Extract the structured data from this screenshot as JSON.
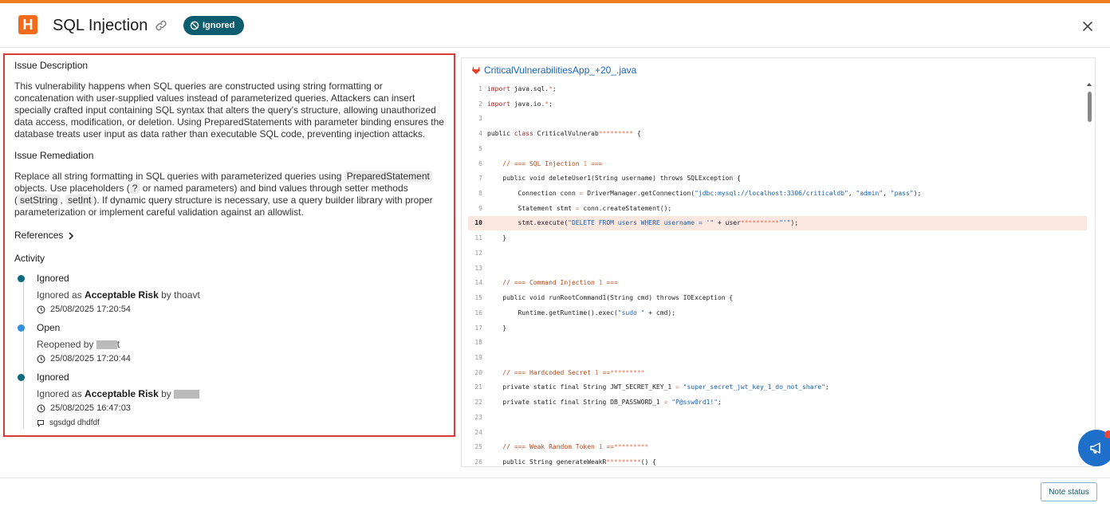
{
  "header": {
    "logo_letter": "H",
    "title": "SQL Injection",
    "status_badge": "Ignored",
    "icons": [
      "link-icon",
      "ban-icon",
      "close-icon"
    ]
  },
  "issue": {
    "description_title": "Issue Description",
    "description": "This vulnerability happens when SQL queries are constructed using string formatting or concatenation with user-supplied values instead of parameterized queries. Attackers can insert specially crafted input containing SQL syntax that alters the query's structure, allowing unauthorized data access, modification, or deletion. Using PreparedStatements with parameter binding ensures the database treats user input as data rather than executable SQL code, preventing injection attacks.",
    "remediation_title": "Issue Remediation",
    "remediation": {
      "t1": "Replace all string formatting in SQL queries with parameterized queries using ",
      "c1": "PreparedStatement",
      "t2": " objects. Use placeholders (",
      "c2": "?",
      "t3": " or named parameters) and bind values through setter methods (",
      "c3": "setString",
      "t4": ", ",
      "c4": "setInt",
      "t5": "). If dynamic query structure is necessary, use a query builder library with proper parameterization or implement careful validation against an allowlist."
    },
    "references_label": "References",
    "activity_title": "Activity"
  },
  "activity": [
    {
      "status": "Ignored",
      "pre": "Ignored as ",
      "bold": "Acceptable Risk",
      "post": " by thoavt",
      "time": "25/08/2025 17:20:54",
      "dot": "#0b6b7d"
    },
    {
      "status": "Open",
      "pre": "Reopened by ",
      "bold": "",
      "post": "t",
      "time": "25/08/2025 17:20:44",
      "dot": "#2f8fe0"
    },
    {
      "status": "Ignored",
      "pre": "Ignored as ",
      "bold": "Acceptable Risk",
      "post": " by ",
      "time": "25/08/2025 16:47:03",
      "note": "sgsdgd dhdfdf",
      "dot": "#0b6b7d"
    }
  ],
  "file": {
    "name": "CriticalVulnerabilitiesApp_+20_.java",
    "highlight_line": 10
  },
  "code": [
    {
      "n": "1",
      "seg": [
        [
          "kw",
          "import"
        ],
        [
          "tx",
          " java.sql."
        ],
        [
          "num",
          "*"
        ],
        [
          "tx",
          ";"
        ]
      ]
    },
    {
      "n": "2",
      "seg": [
        [
          "kw",
          "import"
        ],
        [
          "tx",
          " java.io."
        ],
        [
          "num",
          "*"
        ],
        [
          "tx",
          ";"
        ]
      ]
    },
    {
      "n": "3",
      "seg": []
    },
    {
      "n": "4",
      "seg": [
        [
          "tx",
          "public "
        ],
        [
          "kw",
          "class"
        ],
        [
          "tx",
          " CriticalVulnerab"
        ],
        [
          "num",
          "*********"
        ],
        [
          "tx",
          " {"
        ]
      ]
    },
    {
      "n": "5",
      "seg": []
    },
    {
      "n": "6",
      "seg": [
        [
          "tx",
          "    "
        ],
        [
          "cm",
          "// === SQL Injection "
        ],
        [
          "num",
          "1"
        ],
        [
          "cm",
          " ==="
        ]
      ]
    },
    {
      "n": "7",
      "seg": [
        [
          "tx",
          "    public void deleteUser1(String username) throws SQLException {"
        ]
      ]
    },
    {
      "n": "8",
      "seg": [
        [
          "tx",
          "        Connection conn "
        ],
        [
          "num",
          "="
        ],
        [
          "tx",
          " DriverManager.getConnection("
        ],
        [
          "str",
          "\"jdbc:mysql://localhost:3306/criticaldb\""
        ],
        [
          "tx",
          ", "
        ],
        [
          "str",
          "\"admin\""
        ],
        [
          "tx",
          ", "
        ],
        [
          "str",
          "\"pass\""
        ],
        [
          "tx",
          ");"
        ]
      ]
    },
    {
      "n": "9",
      "seg": [
        [
          "tx",
          "        Statement stmt "
        ],
        [
          "num",
          "="
        ],
        [
          "tx",
          " conn.createStatement();"
        ]
      ]
    },
    {
      "n": "10",
      "seg": [
        [
          "tx",
          "        stmt.execute("
        ],
        [
          "str",
          "\"DELETE FROM users WHERE username = '\""
        ],
        [
          "tx",
          " + user"
        ],
        [
          "num",
          "**********"
        ],
        [
          "str",
          "\"'\""
        ],
        [
          "tx",
          ");"
        ]
      ]
    },
    {
      "n": "11",
      "seg": [
        [
          "tx",
          "    }"
        ]
      ]
    },
    {
      "n": "12",
      "seg": []
    },
    {
      "n": "13",
      "seg": []
    },
    {
      "n": "14",
      "seg": [
        [
          "tx",
          "    "
        ],
        [
          "cm",
          "// === Command Injection "
        ],
        [
          "num",
          "1"
        ],
        [
          "cm",
          " ==="
        ]
      ]
    },
    {
      "n": "15",
      "seg": [
        [
          "tx",
          "    public void runRootCommand1(String cmd) throws IOException {"
        ]
      ]
    },
    {
      "n": "16",
      "seg": [
        [
          "tx",
          "        Runtime.getRuntime().exec("
        ],
        [
          "str",
          "\"sudo \""
        ],
        [
          "tx",
          " + cmd);"
        ]
      ]
    },
    {
      "n": "17",
      "seg": [
        [
          "tx",
          "    }"
        ]
      ]
    },
    {
      "n": "18",
      "seg": []
    },
    {
      "n": "19",
      "seg": []
    },
    {
      "n": "20",
      "seg": [
        [
          "tx",
          "    "
        ],
        [
          "cm",
          "// === Hardcoded Secret "
        ],
        [
          "num",
          "1"
        ],
        [
          "cm",
          " =="
        ],
        [
          "num",
          "*********"
        ]
      ]
    },
    {
      "n": "21",
      "seg": [
        [
          "tx",
          "    private static final String JWT_SECRET_KEY_1 "
        ],
        [
          "num",
          "="
        ],
        [
          "tx",
          " "
        ],
        [
          "str",
          "\"super_secret_jwt_key_1_do_not_share\""
        ],
        [
          "tx",
          ";"
        ]
      ]
    },
    {
      "n": "22",
      "seg": [
        [
          "tx",
          "    private static final String DB_PASSWORD_1 "
        ],
        [
          "num",
          "="
        ],
        [
          "tx",
          " "
        ],
        [
          "str",
          "\"P@ssw0rd1!\""
        ],
        [
          "tx",
          ";"
        ]
      ]
    },
    {
      "n": "23",
      "seg": []
    },
    {
      "n": "24",
      "seg": []
    },
    {
      "n": "25",
      "seg": [
        [
          "tx",
          "    "
        ],
        [
          "cm",
          "// === Weak Random Token "
        ],
        [
          "num",
          "1"
        ],
        [
          "cm",
          " =="
        ],
        [
          "num",
          "*********"
        ]
      ]
    },
    {
      "n": "26",
      "seg": [
        [
          "tx",
          "    public String generateWeakR"
        ],
        [
          "num",
          "*********"
        ],
        [
          "tx",
          "() {"
        ]
      ]
    }
  ],
  "footer": {
    "note_status_label": "Note status"
  },
  "colors": {
    "accent": "#ef7d22",
    "logo": "#f26b1d",
    "badge": "#0b5d6f",
    "highlight_border": "#d93b3b",
    "link": "#1e63b5",
    "fab": "#1d6fc9"
  }
}
